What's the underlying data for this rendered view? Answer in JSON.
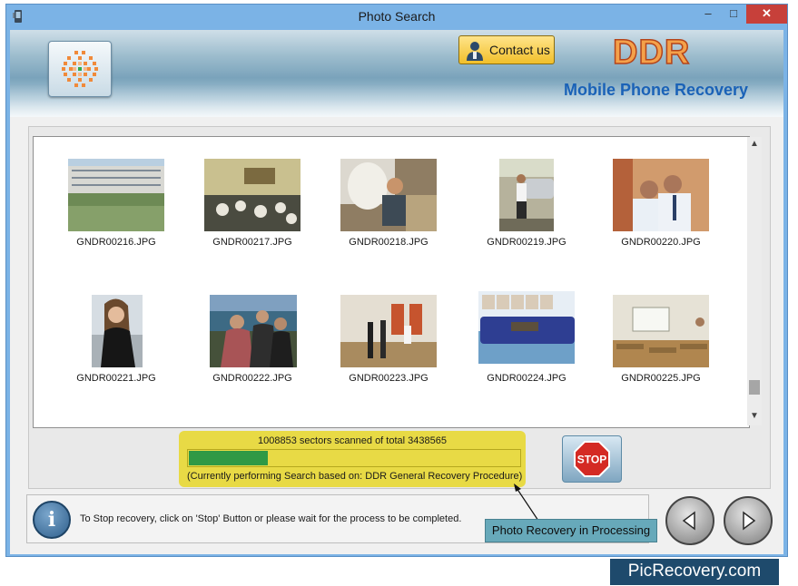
{
  "window": {
    "title": "Photo Search",
    "controls": {
      "minimize": "–",
      "maximize": "□",
      "close": "✕"
    }
  },
  "header": {
    "contact_label": "Contact us",
    "brand": "DDR",
    "subtitle": "Mobile Phone Recovery"
  },
  "gallery": {
    "items": [
      {
        "label": "GNDR00216.JPG"
      },
      {
        "label": "GNDR00217.JPG"
      },
      {
        "label": "GNDR00218.JPG"
      },
      {
        "label": "GNDR00219.JPG"
      },
      {
        "label": "GNDR00220.JPG"
      },
      {
        "label": "GNDR00221.JPG"
      },
      {
        "label": "GNDR00222.JPG"
      },
      {
        "label": "GNDR00223.JPG"
      },
      {
        "label": "GNDR00224.JPG"
      },
      {
        "label": "GNDR00225.JPG"
      }
    ]
  },
  "scan": {
    "status_text": "1008853 sectors scanned of total 3438565",
    "sectors_scanned": 1008853,
    "sectors_total": 3438565,
    "progress_fraction": 0.24,
    "method_text": "(Currently performing Search based on:  DDR General Recovery Procedure)"
  },
  "stop_button": {
    "label": "STOP"
  },
  "footer": {
    "hint": "To Stop recovery, click on 'Stop' Button or please wait for the process to be completed.",
    "callout": "Photo Recovery in Processing"
  },
  "icons": {
    "info": "i",
    "back": "left-arrow-icon",
    "next": "right-arrow-icon"
  },
  "watermark": "PicRecovery.com",
  "colors": {
    "progress_fill": "#2f9945",
    "scan_panel": "#e8da45",
    "stop_red": "#d42a24",
    "brand_orange": "#f4a14a",
    "subtitle_blue": "#1a62b7",
    "callout": "#67a9ba"
  }
}
